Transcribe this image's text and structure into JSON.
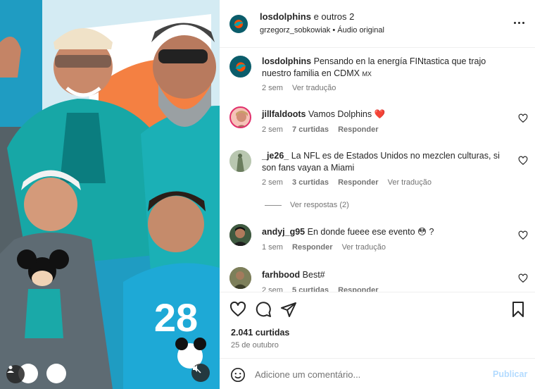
{
  "post": {
    "author": "losdolphins",
    "coauthors_text": " e outros 2",
    "subline_user": "grzegorz_sobkowiak",
    "subline_sep": " • ",
    "subline_audio": "Áudio original",
    "flag_text": "MX"
  },
  "caption": {
    "user": "losdolphins",
    "text": "Pensando en la energía FINtastica que trajo nuestro familia en CDMX",
    "flag": "MX",
    "time": "2 sem",
    "translate": "Ver tradução"
  },
  "comments": [
    {
      "user": "jillfaldoots",
      "text": "Vamos Dolphins ❤️",
      "time": "2 sem",
      "likes": "7 curtidas",
      "reply": "Responder",
      "translate": ""
    },
    {
      "user": "_je26_",
      "text": "La NFL es de Estados Unidos no mezclen culturas, si son fans vayan a Miami",
      "time": "2 sem",
      "likes": "3 curtidas",
      "reply": "Responder",
      "translate": "Ver tradução",
      "view_replies": "Ver respostas (2)"
    },
    {
      "user": "andyj_g95",
      "text": "En donde fueee ese evento 😳 ?",
      "time": "1 sem",
      "likes": "",
      "reply": "Responder",
      "translate": "Ver tradução"
    },
    {
      "user": "farhbood",
      "text": "Best#",
      "time": "2 sem",
      "likes": "5 curtidas",
      "reply": "Responder",
      "translate": ""
    }
  ],
  "footer": {
    "likes": "2.041 curtidas",
    "date": "25 de outubro"
  },
  "composer": {
    "placeholder": "Adicione um comentário...",
    "post_label": "Publicar"
  },
  "colors": {
    "dolphins_aqua": "#008e97",
    "dolphins_orange": "#fc4c02",
    "post_disabled": "#b3dbff",
    "heart_red": "#ed4956"
  },
  "icons": [
    "heart-icon",
    "comment-icon",
    "share-icon",
    "bookmark-icon",
    "emoji-icon",
    "more-icon",
    "user-tag-icon",
    "mute-icon"
  ]
}
